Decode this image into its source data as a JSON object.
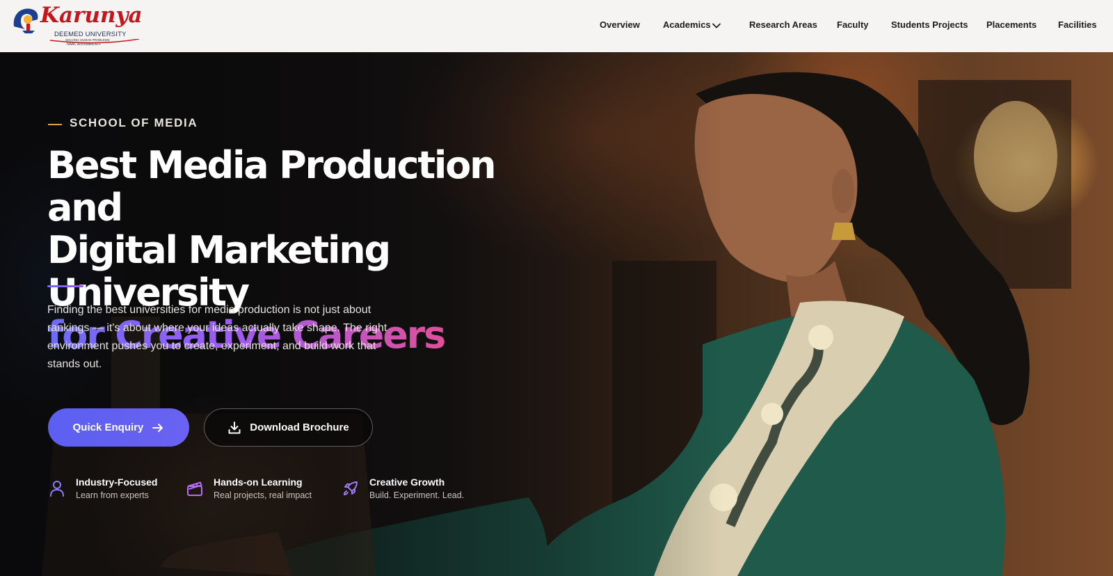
{
  "header": {
    "logo": {
      "name": "Karunya",
      "subtitle": "DEEMED UNIVERSITY",
      "tagline": "SOLVING HUMAN PROBLEMS",
      "accreditation": "NAAC Accredited A++"
    },
    "nav": [
      {
        "label": "Overview"
      },
      {
        "label": "Academics",
        "has_dropdown": true
      },
      {
        "label": "Research Areas"
      },
      {
        "label": "Faculty"
      },
      {
        "label": "Students Projects"
      },
      {
        "label": "Placements"
      },
      {
        "label": "Facilities"
      }
    ]
  },
  "hero": {
    "eyebrow": "SCHOOL OF MEDIA",
    "headline_line1": "Best Media Production and",
    "headline_line2": "Digital Marketing University",
    "headline_line3": "for Creative Careers",
    "description": "Finding the best universities for media production is not just about rankings — it's about where your ideas actually take shape. The right environment pushes you to create, experiment, and build work that stands out.",
    "primary_button": {
      "label": "Quick Enquiry",
      "icon": "arrow-right-icon"
    },
    "secondary_button": {
      "label": "Download Brochure",
      "icon": "download-icon"
    },
    "features": [
      {
        "title": "Industry-Focused",
        "subtitle": "Learn from experts",
        "icon": "user-icon"
      },
      {
        "title": "Hands-on Learning",
        "subtitle": "Real projects, real impact",
        "icon": "clapperboard-icon"
      },
      {
        "title": "Creative Growth",
        "subtitle": "Build. Experiment. Lead.",
        "icon": "rocket-icon"
      }
    ],
    "colors": {
      "accent_primary": "#5b5ff0",
      "gradient_end": "#e0509a",
      "eyebrow_line": "#d9a441"
    }
  }
}
